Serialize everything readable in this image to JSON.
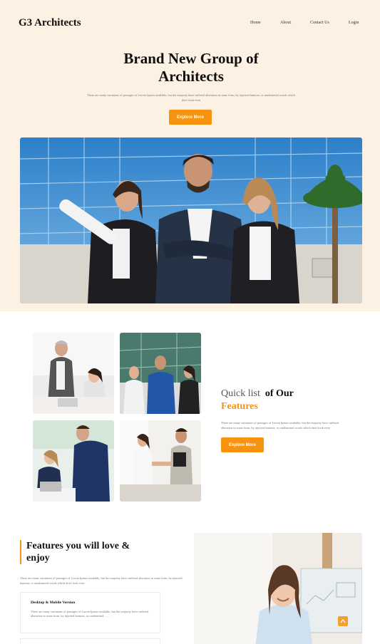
{
  "brand": "G3 Architects",
  "nav": {
    "home": "Home",
    "about": "About",
    "contact": "Contact Us",
    "login": "Login"
  },
  "hero": {
    "title_line1": "Brand New Group of",
    "title_line2": "Architects",
    "description": "There are many variations of passages of Lorem Ipsum available, but the majority have suffered alteration in some form, by injected humour, or randomised words which don't look even",
    "button": "Explore More",
    "photo": "team-of-three-architects-photo"
  },
  "quick_list": {
    "title_part1": "Quick list",
    "title_part2": "of Our",
    "title_part3": "Features",
    "description": "There are many variations of passages of Lorem Ipsum available, but the majority have suffered alteration in some form, by injected humour, or randomised words which don't look even",
    "button": "Explore More",
    "tiles": [
      "office-meeting-photo",
      "business-team-photo",
      "laptop-discussion-photo",
      "handshake-photo"
    ]
  },
  "love": {
    "title": "Features you will love & enjoy",
    "description": "There are many variations of passages of Lorem Ipsum available, but the majority have suffered alteration in some form, by injected humour, or randomised words which don't look even",
    "card": {
      "title": "Desktop & Mobile Version",
      "description": "There are many variations of passages of Lorem Ipsum available, but the majority have suffered alteration in some form, by injected humour, or randomised . . . . . ."
    },
    "photo": "smiling-woman-office-photo"
  },
  "colors": {
    "accent": "#f7930e",
    "hero_bg": "#fdf1e3"
  },
  "icons": {
    "scroll_top": "arrow-up-icon"
  }
}
